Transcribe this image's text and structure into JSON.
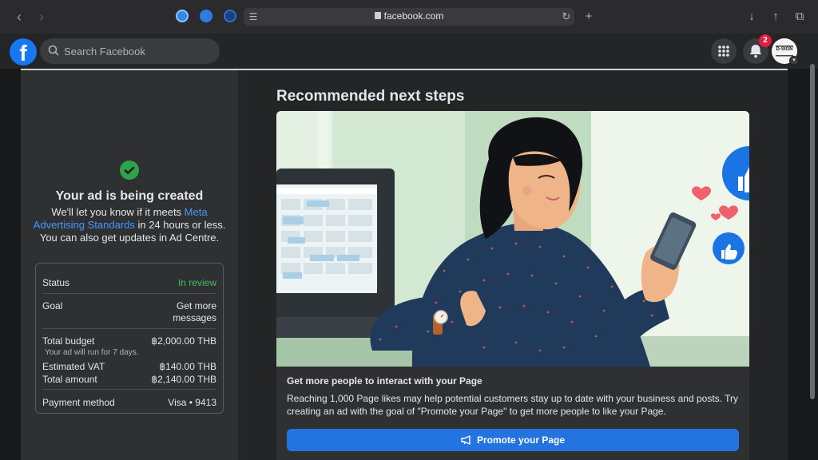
{
  "browser": {
    "url": "facebook.com"
  },
  "header": {
    "search_placeholder": "Search Facebook",
    "notification_count": "2",
    "avatar_label": "D-SIGN"
  },
  "status_panel": {
    "title": "Your ad is being created",
    "desc_before": "We'll let you know if it meets ",
    "desc_link": "Meta Advertising Standards",
    "desc_after": " in 24 hours or less. You can also get updates in Ad Centre.",
    "rows": {
      "status_label": "Status",
      "status_value": "In review",
      "goal_label": "Goal",
      "goal_value_1": "Get more",
      "goal_value_2": "messages",
      "budget_label": "Total budget",
      "budget_value": "฿2,000.00 THB",
      "budget_note": "Your ad will run for 7 days.",
      "vat_label": "Estimated VAT",
      "vat_value": "฿140.00 THB",
      "total_label": "Total amount",
      "total_value": "฿2,140.00 THB",
      "payment_label": "Payment method",
      "payment_value": "Visa • 9413"
    }
  },
  "next_steps": {
    "title": "Recommended next steps",
    "card_heading": "Get more people to interact with your Page",
    "card_body": "Reaching 1,000 Page likes may help potential customers stay up to date with your business and posts. Try creating an ad with the goal of \"Promote your Page\" to get more people to like your Page.",
    "button_label": "Promote your Page"
  },
  "colors": {
    "fb_blue": "#1877f2",
    "success_green": "#31a24c",
    "link_blue": "#4599ff",
    "badge_red": "#e41e3f"
  }
}
